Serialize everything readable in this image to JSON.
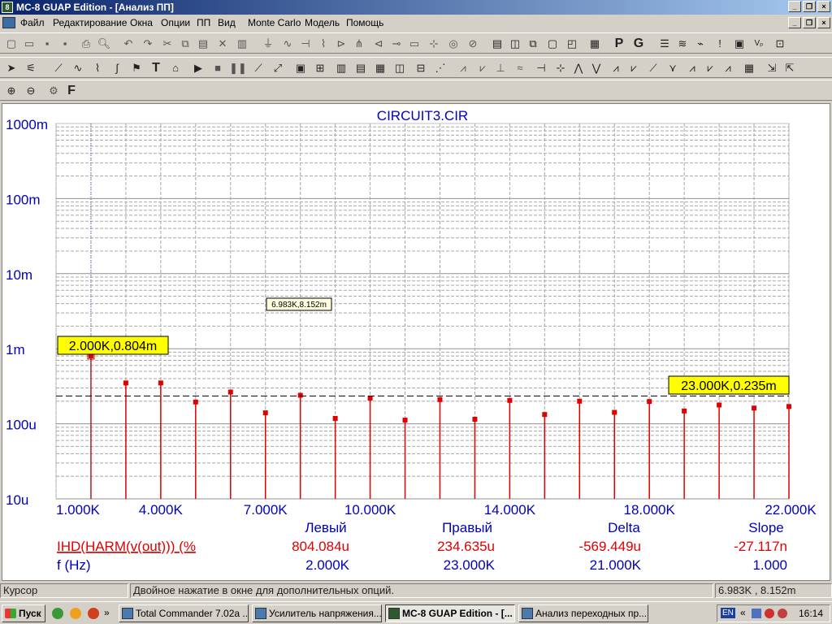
{
  "window": {
    "title": "MC-8 GUAP Edition - [Анализ ПП]"
  },
  "menu": [
    "Файл",
    "Редактирование",
    "Окна",
    "Опции",
    "ПП",
    "Вид",
    "Monte Carlo",
    "Модель",
    "Помощь"
  ],
  "chart": {
    "title": "CIRCUIT3.CIR",
    "y_ticks": [
      "1000m",
      "100m",
      "10m",
      "1m",
      "100u",
      "10u"
    ],
    "x_ticks": [
      "1.000K",
      "4.000K",
      "7.000K",
      "10.000K",
      "14.000K",
      "18.000K",
      "22.000K"
    ],
    "tooltip_small": "6.983K,8.152m",
    "cursor_left_label": "2.000K,0.804m",
    "cursor_right_label": "23.000K,0.235m"
  },
  "chart_data": {
    "type": "bar",
    "title": "CIRCUIT3.CIR",
    "x_unit": "Hz",
    "y_scale": "log",
    "ylim": [
      1e-05,
      1.0
    ],
    "xlim": [
      1000,
      22000
    ],
    "grid": true,
    "x": [
      2000,
      3000,
      4000,
      5000,
      6000,
      7000,
      8000,
      9000,
      10000,
      11000,
      12000,
      13000,
      14000,
      15000,
      16000,
      17000,
      18000,
      19000,
      20000,
      21000,
      22000
    ],
    "values": [
      0.000804,
      0.00035,
      0.00035,
      0.000195,
      0.000265,
      0.00014,
      0.00024,
      0.000118,
      0.00022,
      0.000112,
      0.00021,
      0.000115,
      0.000205,
      0.000133,
      0.0002,
      0.000142,
      0.000198,
      0.000148,
      0.000178,
      0.000162,
      0.00017
    ],
    "series": [
      {
        "name": "IHD(HARM(v(out))) (%"
      }
    ],
    "cursor_left": {
      "x": 2000,
      "y": 0.000804
    },
    "cursor_right": {
      "x": 23000,
      "y": 0.000235
    }
  },
  "readout": {
    "headers": [
      "Левый",
      "Правый",
      "Delta",
      "Slope"
    ],
    "rows": [
      {
        "label": "IHD(HARM(v(out))) (%",
        "values": [
          "804.084u",
          "234.635u",
          "-569.449u",
          "-27.117n"
        ]
      },
      {
        "label": "f (Hz)",
        "values": [
          "2.000K",
          "23.000K",
          "21.000K",
          "1.000"
        ]
      }
    ]
  },
  "status": {
    "mode": "Курсор",
    "hint": "Двойное нажатие в окне для дополнительных опций.",
    "coords": "6.983K , 8.152m"
  },
  "taskbar": {
    "start": "Пуск",
    "tasks": [
      "Total Commander 7.02a ...",
      "Усилитель напряжения...",
      "MC-8 GUAP Edition - [...",
      "Анализ переходных пр..."
    ],
    "time": "16:14",
    "lang": "EN"
  },
  "colors": {
    "axis_text": "#0000c0",
    "bar": "#e00000",
    "cursor_label_bg": "#ffff00"
  }
}
